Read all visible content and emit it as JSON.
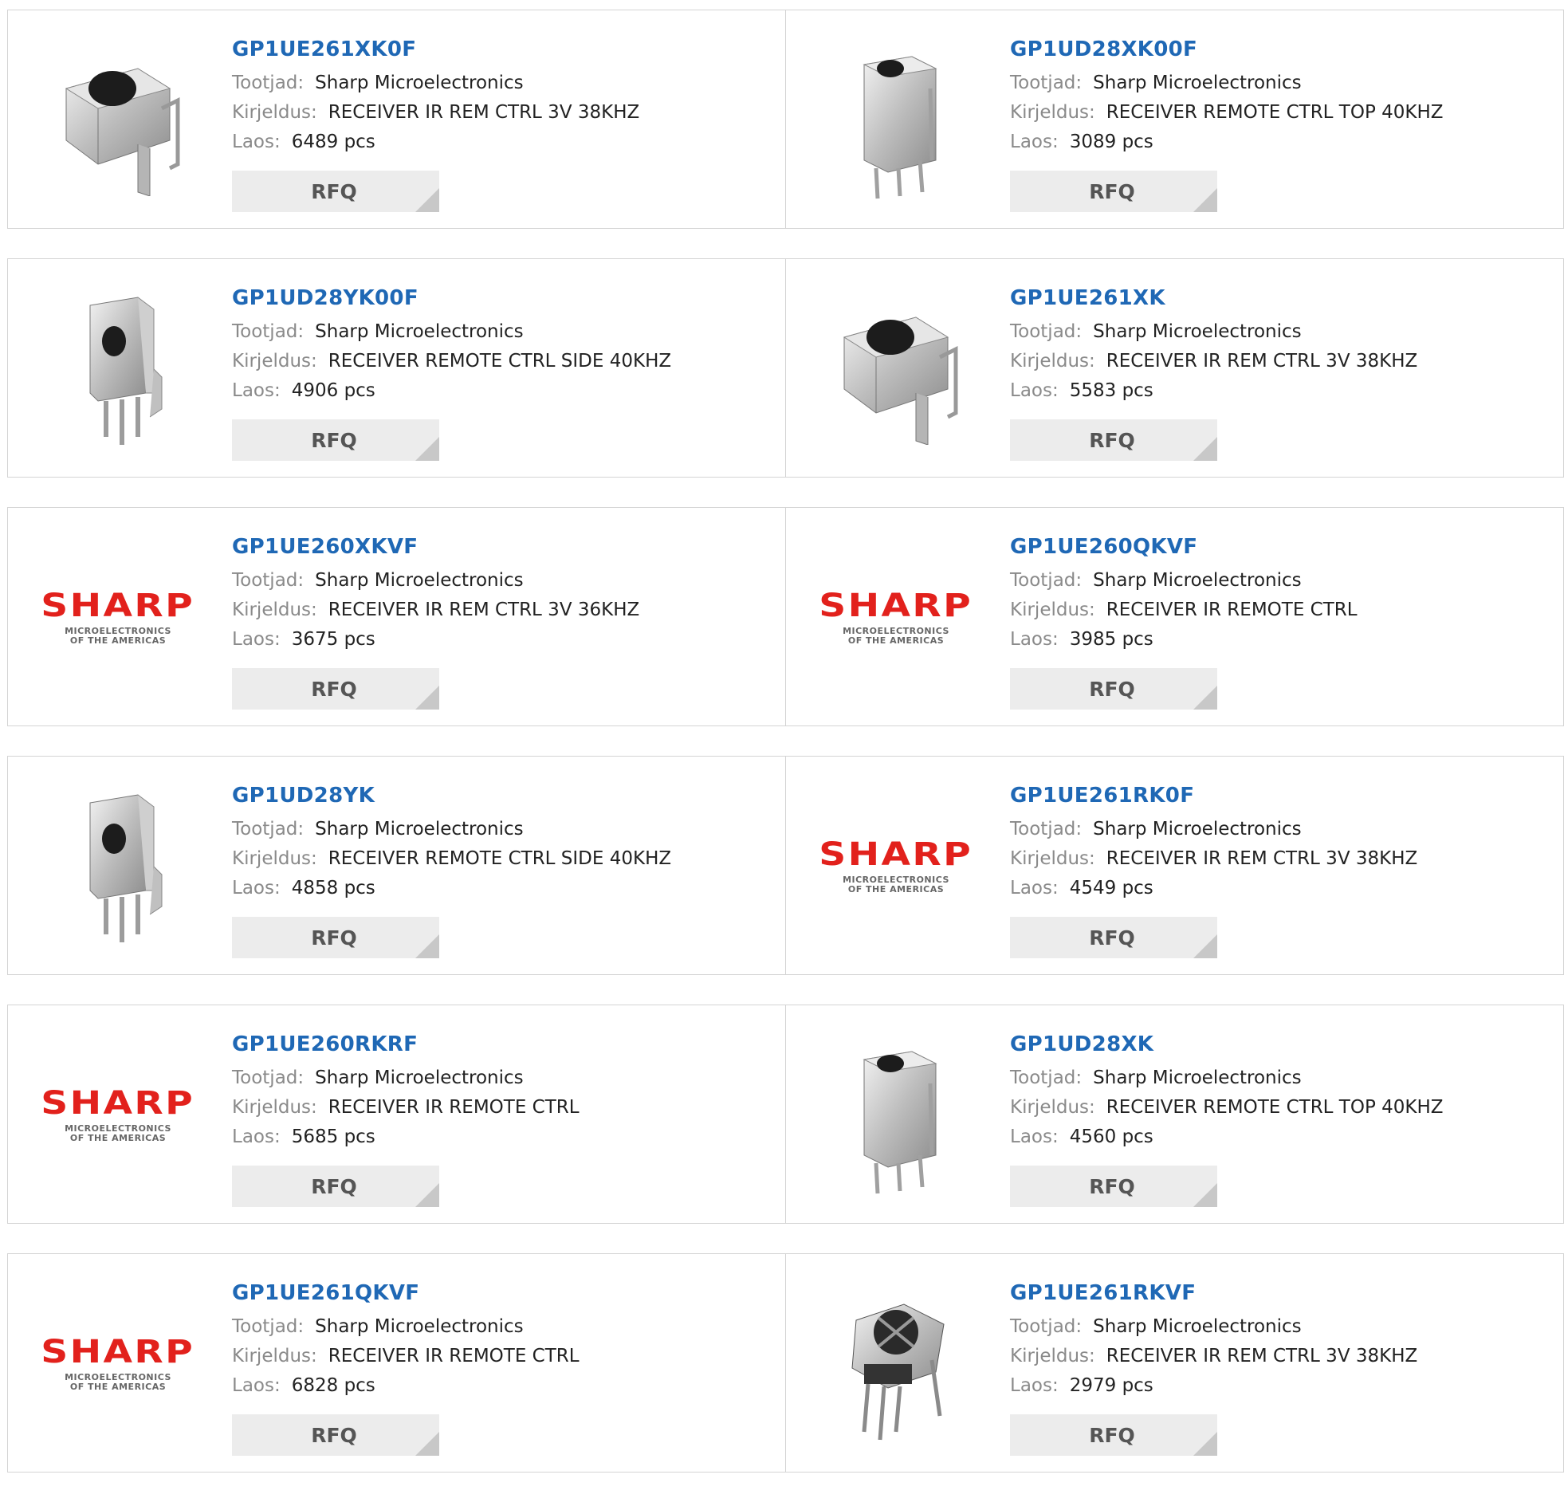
{
  "labels": {
    "manufacturer": "Tootjad:",
    "description": "Kirjeldus:",
    "stock": "Laos:",
    "rfq": "RFQ"
  },
  "logo": {
    "word": "SHARP",
    "line1": "MICROELECTRONICS",
    "line2": "OF THE AMERICAS",
    "color": "#e2211c"
  },
  "colors": {
    "link": "#1f68b5",
    "label": "#8a8a8a",
    "button_bg": "#ececec"
  },
  "products": [
    {
      "part": "GP1UE261XK0F",
      "manufacturer": "Sharp Microelectronics",
      "description": "RECEIVER IR REM CTRL 3V 38KHZ",
      "stock": "6489 pcs",
      "image": "metal-top-receiver"
    },
    {
      "part": "GP1UD28XK00F",
      "manufacturer": "Sharp Microelectronics",
      "description": "RECEIVER REMOTE CTRL TOP 40KHZ",
      "stock": "3089 pcs",
      "image": "tall-top-receiver"
    },
    {
      "part": "GP1UD28YK00F",
      "manufacturer": "Sharp Microelectronics",
      "description": "RECEIVER REMOTE CTRL SIDE 40KHZ",
      "stock": "4906 pcs",
      "image": "side-receiver"
    },
    {
      "part": "GP1UE261XK",
      "manufacturer": "Sharp Microelectronics",
      "description": "RECEIVER IR REM CTRL 3V 38KHZ",
      "stock": "5583 pcs",
      "image": "metal-top-receiver"
    },
    {
      "part": "GP1UE260XKVF",
      "manufacturer": "Sharp Microelectronics",
      "description": "RECEIVER IR REM CTRL 3V 36KHZ",
      "stock": "3675 pcs",
      "image": "sharp-logo"
    },
    {
      "part": "GP1UE260QKVF",
      "manufacturer": "Sharp Microelectronics",
      "description": "RECEIVER IR REMOTE CTRL",
      "stock": "3985 pcs",
      "image": "sharp-logo"
    },
    {
      "part": "GP1UD28YK",
      "manufacturer": "Sharp Microelectronics",
      "description": "RECEIVER REMOTE CTRL SIDE 40KHZ",
      "stock": "4858 pcs",
      "image": "side-receiver"
    },
    {
      "part": "GP1UE261RK0F",
      "manufacturer": "Sharp Microelectronics",
      "description": "RECEIVER IR REM CTRL 3V 38KHZ",
      "stock": "4549 pcs",
      "image": "sharp-logo"
    },
    {
      "part": "GP1UE260RKRF",
      "manufacturer": "Sharp Microelectronics",
      "description": "RECEIVER IR REMOTE CTRL",
      "stock": "5685 pcs",
      "image": "sharp-logo"
    },
    {
      "part": "GP1UD28XK",
      "manufacturer": "Sharp Microelectronics",
      "description": "RECEIVER REMOTE CTRL TOP 40KHZ",
      "stock": "4560 pcs",
      "image": "tall-top-receiver"
    },
    {
      "part": "GP1UE261QKVF",
      "manufacturer": "Sharp Microelectronics",
      "description": "RECEIVER IR REMOTE CTRL",
      "stock": "6828 pcs",
      "image": "sharp-logo"
    },
    {
      "part": "GP1UE261RKVF",
      "manufacturer": "Sharp Microelectronics",
      "description": "RECEIVER IR REM CTRL 3V 38KHZ",
      "stock": "2979 pcs",
      "image": "angled-receiver"
    }
  ]
}
